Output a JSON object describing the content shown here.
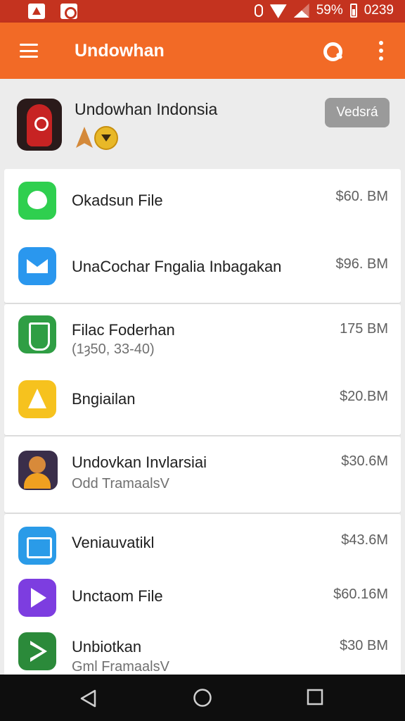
{
  "status_bar": {
    "battery_text": "59%",
    "time": "0239",
    "bg_color": "#c4331f",
    "icons": [
      "app-notification-icon",
      "app-notification-icon",
      "vibrate-icon",
      "wifi-icon",
      "signal-icon",
      "battery-icon"
    ]
  },
  "app_bar": {
    "title": "Undowhan",
    "bg_color": "#f26a26",
    "icons": [
      "menu-icon",
      "search-icon",
      "more-vert-icon"
    ]
  },
  "featured": {
    "name": "Undowhan Indonsia",
    "button_label": "Vedsrá"
  },
  "items": [
    {
      "title": "Okadsun File",
      "subtitle": "",
      "size": "$60. BM",
      "icon": "chat-bubble-icon",
      "icon_color": "#2fcf4f"
    },
    {
      "title": "UnaCochar Fngalia Inbagakan",
      "subtitle": "",
      "size": "$96. BM",
      "icon": "mail-icon",
      "icon_color": "#2a97ee"
    },
    {
      "title": "Filac Foderhan",
      "subtitle": "(1ȝ50, 33-40)",
      "size": "175 BM",
      "icon": "file-icon",
      "icon_color": "#2f9e44"
    },
    {
      "title": "Bngiailan",
      "subtitle": "",
      "size": "$20.BM",
      "icon": "cone-icon",
      "icon_color": "#f6c21e"
    },
    {
      "title": "Undovkan Invlarsiai",
      "subtitle": "Odd TramaalsV",
      "size": "$30.6M",
      "icon": "avatar-icon",
      "icon_color": "#3a2e4a"
    },
    {
      "title": "Veniauvatikl",
      "subtitle": "",
      "size": "$43.6M",
      "icon": "image-icon",
      "icon_color": "#2a9be8"
    },
    {
      "title": "Unctaom File",
      "subtitle": "",
      "size": "$60.16M",
      "icon": "play-icon",
      "icon_color": "#7d3de0"
    },
    {
      "title": "Unbiotkan",
      "subtitle": "Gml FramaalsV",
      "size": "$30 BM",
      "icon": "play-store-icon",
      "icon_color": "#2b8a3a"
    }
  ],
  "nav_bar": {
    "icons": [
      "back-icon",
      "home-icon",
      "recents-icon"
    ]
  }
}
